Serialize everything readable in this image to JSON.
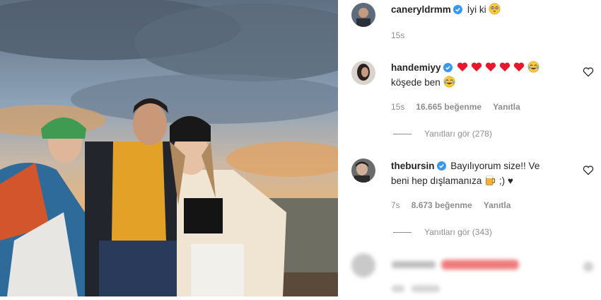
{
  "comments": [
    {
      "username": "caneryldrmm",
      "text": "İyi ki",
      "time": "15s",
      "emoji": "flushed-face-icon"
    },
    {
      "username": "handemiyy",
      "text": "köşede ben",
      "time": "15s",
      "likes": "16.665 beğenme",
      "reply_label": "Yanıtla",
      "view_replies": "Yanıtları gör (278)"
    },
    {
      "username": "thebursin",
      "text_line1": "Bayılıyorum size!! Ve",
      "text_line2": "beni hep dışlamanıza",
      "text_tail": ";) ♥",
      "time": "7s",
      "likes": "8.673 beğenme",
      "reply_label": "Yanıtla",
      "view_replies": "Yanıtları gör (343)"
    }
  ],
  "colors": {
    "verified": "#3897f0",
    "heart": "#e8172c",
    "muted": "#8e8e8e"
  }
}
